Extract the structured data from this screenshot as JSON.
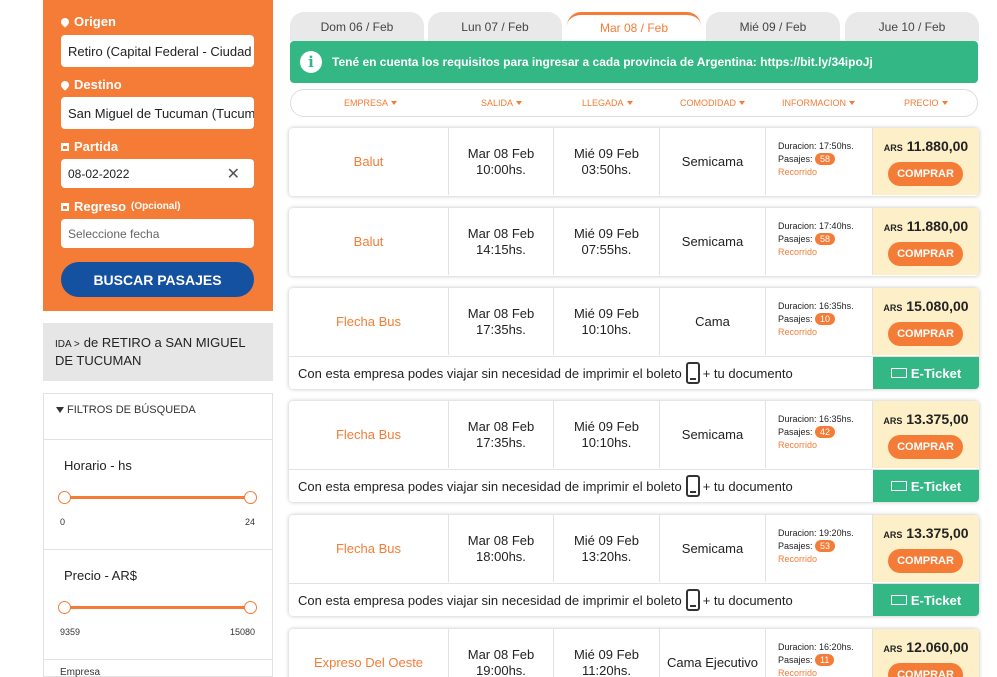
{
  "search": {
    "origin_label": "Origen",
    "origin_value": "Retiro (Capital Federal - Ciudad",
    "destination_label": "Destino",
    "destination_value": "San Miguel de Tucuman (Tucumá",
    "departure_label": "Partida",
    "departure_value": "08-02-2022",
    "return_label": "Regreso",
    "return_optional": "(Opcional)",
    "return_placeholder": "Seleccione fecha",
    "button_label": "BUSCAR PASAJES"
  },
  "route": {
    "ida": "IDA >",
    "text": "de RETIRO a  SAN MIGUEL DE TUCUMAN"
  },
  "filters": {
    "header": "FILTROS DE BÚSQUEDA",
    "horario": {
      "title": "Horario - hs",
      "min": "0",
      "max": "24"
    },
    "precio": {
      "title": "Precio - AR$",
      "min": "9359",
      "max": "15080"
    },
    "next": "Empresa"
  },
  "date_tabs": [
    {
      "label": "Dom 06 / Feb",
      "active": false
    },
    {
      "label": "Lun 07 / Feb",
      "active": false
    },
    {
      "label": "Mar 08 / Feb",
      "active": true
    },
    {
      "label": "Mié 09 / Feb",
      "active": false
    },
    {
      "label": "Jue 10 / Feb",
      "active": false
    }
  ],
  "info_bar": {
    "icon": "i",
    "text": "Tené en cuenta los requisitos para ingresar a cada provincia de Argentina: https://bit.ly/34ipoJj"
  },
  "sort_bar": {
    "empresa": "EMPRESA",
    "salida": "SALIDA",
    "llegada": "LLEGADA",
    "comodidad": "COMODIDAD",
    "informacion": "INFORMACION",
    "precio": "PRECIO"
  },
  "labels": {
    "duracion": "Duracion:",
    "pasajes": "Pasajes:",
    "recorrido": "Recorrido",
    "currency": "ARS",
    "buy": "COMPRAR",
    "eticket_msg_a": "Con esta empresa podes viajar sin necesidad de imprimir el boleto",
    "eticket_msg_b": "+ tu documento",
    "eticket_tag": "E-Ticket"
  },
  "results": [
    {
      "company": "Balut",
      "dep_date": "Mar 08 Feb",
      "dep_time": "10:00hs.",
      "arr_date": "Mié 09 Feb",
      "arr_time": "03:50hs.",
      "comfort": "Semicama",
      "duration": "17:50hs.",
      "seats": "58",
      "price": "11.880,00",
      "eticket": false
    },
    {
      "company": "Balut",
      "dep_date": "Mar 08 Feb",
      "dep_time": "14:15hs.",
      "arr_date": "Mié 09 Feb",
      "arr_time": "07:55hs.",
      "comfort": "Semicama",
      "duration": "17:40hs.",
      "seats": "58",
      "price": "11.880,00",
      "eticket": false
    },
    {
      "company": "Flecha Bus",
      "dep_date": "Mar 08 Feb",
      "dep_time": "17:35hs.",
      "arr_date": "Mié 09 Feb",
      "arr_time": "10:10hs.",
      "comfort": "Cama",
      "duration": "16:35hs.",
      "seats": "10",
      "price": "15.080,00",
      "eticket": true
    },
    {
      "company": "Flecha Bus",
      "dep_date": "Mar 08 Feb",
      "dep_time": "17:35hs.",
      "arr_date": "Mié 09 Feb",
      "arr_time": "10:10hs.",
      "comfort": "Semicama",
      "duration": "16:35hs.",
      "seats": "42",
      "price": "13.375,00",
      "eticket": true
    },
    {
      "company": "Flecha Bus",
      "dep_date": "Mar 08 Feb",
      "dep_time": "18:00hs.",
      "arr_date": "Mié 09 Feb",
      "arr_time": "13:20hs.",
      "comfort": "Semicama",
      "duration": "19:20hs.",
      "seats": "53",
      "price": "13.375,00",
      "eticket": true
    },
    {
      "company": "Expreso Del Oeste",
      "dep_date": "Mar 08 Feb",
      "dep_time": "19:00hs.",
      "arr_date": "Mié 09 Feb",
      "arr_time": "11:20hs.",
      "comfort": "Cama Ejecutivo",
      "duration": "16:20hs.",
      "seats": "11",
      "price": "12.060,00",
      "eticket": false
    }
  ],
  "colors": {
    "accent": "#f47c36",
    "brand_blue": "#1451a0",
    "success": "#33b885",
    "price_bg": "#fdf0c8"
  }
}
